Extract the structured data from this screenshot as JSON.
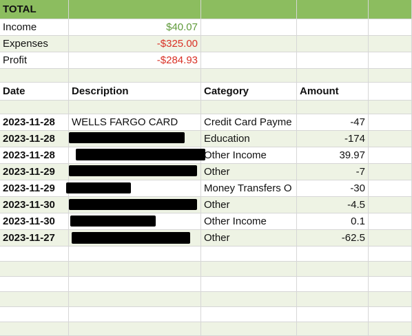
{
  "summary": {
    "title": "TOTAL",
    "income_label": "Income",
    "income_value": "$40.07",
    "expenses_label": "Expenses",
    "expenses_value": "-$325.00",
    "profit_label": "Profit",
    "profit_value": "-$284.93"
  },
  "columns": {
    "date": "Date",
    "description": "Description",
    "category": "Category",
    "amount": "Amount"
  },
  "transactions": [
    {
      "date": "2023-11-28",
      "description": "WELLS FARGO CARD",
      "category": "Credit Card Payme",
      "amount": "-47"
    },
    {
      "date": "2023-11-28",
      "description": "",
      "category": "Education",
      "amount": "-174"
    },
    {
      "date": "2023-11-28",
      "description": "",
      "category": "Other Income",
      "amount": "39.97"
    },
    {
      "date": "2023-11-29",
      "description": "",
      "category": "Other",
      "amount": "-7"
    },
    {
      "date": "2023-11-29",
      "description": "",
      "category": "Money Transfers O",
      "amount": "-30"
    },
    {
      "date": "2023-11-30",
      "description": "",
      "category": "Other",
      "amount": "-4.5"
    },
    {
      "date": "2023-11-30",
      "description": "",
      "category": "Other Income",
      "amount": "0.1"
    },
    {
      "date": "2023-11-27",
      "description": "",
      "category": "Other",
      "amount": "-62.5"
    }
  ],
  "colors": {
    "header_band": "#8cbd5f",
    "alt_band": "#eef3e4",
    "positive": "#5f9a3a",
    "negative": "#d93025"
  }
}
